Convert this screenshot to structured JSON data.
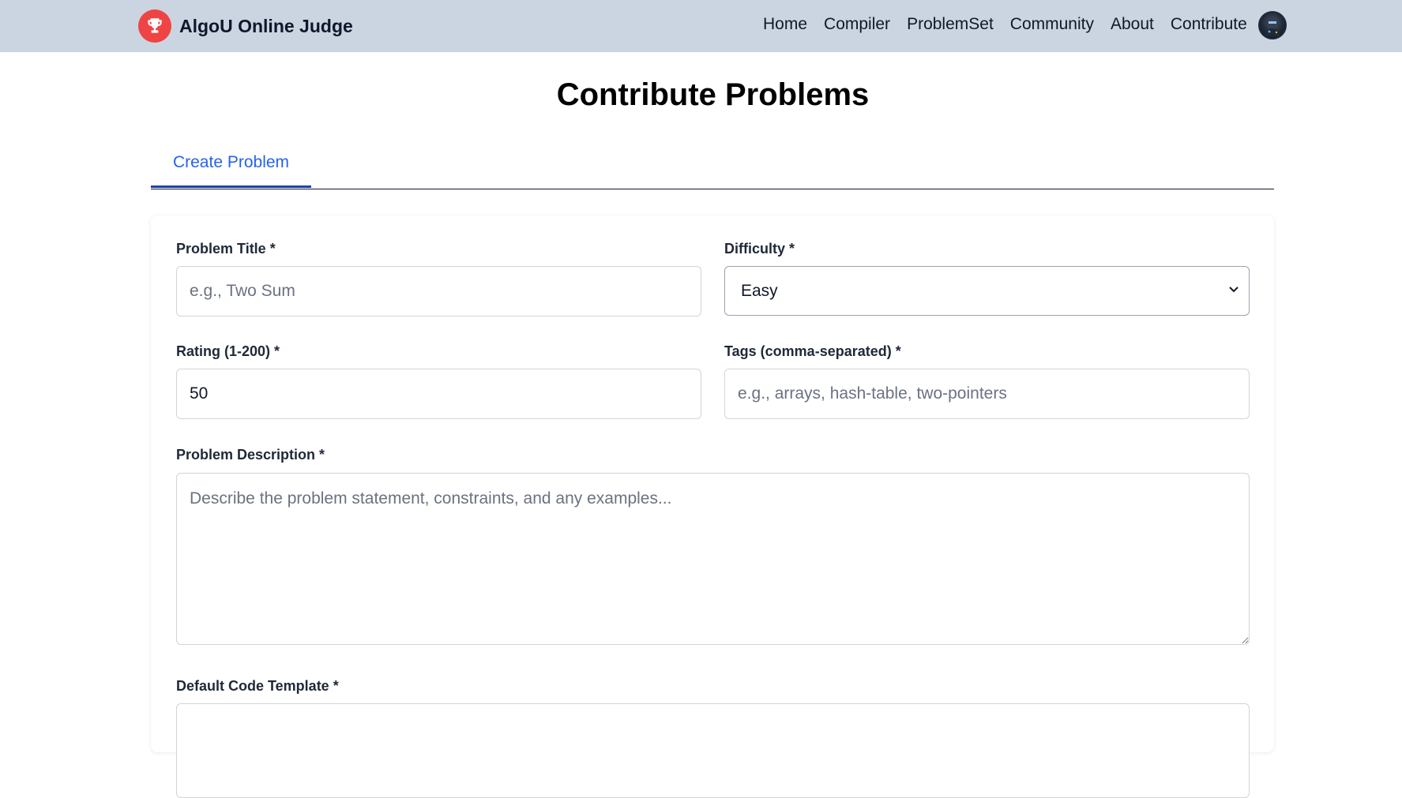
{
  "header": {
    "brand": "AlgoU Online Judge",
    "nav": [
      "Home",
      "Compiler",
      "ProblemSet",
      "Community",
      "About",
      "Contribute"
    ]
  },
  "page": {
    "title": "Contribute Problems",
    "tabs": [
      "Create Problem"
    ]
  },
  "form": {
    "title": {
      "label": "Problem Title *",
      "placeholder": "e.g., Two Sum",
      "value": ""
    },
    "difficulty": {
      "label": "Difficulty *",
      "value": "Easy"
    },
    "rating": {
      "label": "Rating (1-200) *",
      "value": "50"
    },
    "tags": {
      "label": "Tags (comma-separated) *",
      "placeholder": "e.g., arrays, hash-table, two-pointers",
      "value": ""
    },
    "description": {
      "label": "Problem Description *",
      "placeholder": "Describe the problem statement, constraints, and any examples...",
      "value": ""
    },
    "template": {
      "label": "Default Code Template *"
    }
  },
  "colors": {
    "navbar_bg": "#cbd5e1",
    "brand_logo": "#ef4444",
    "active_tab": "#2563eb",
    "tab_underline": "#1e40af"
  },
  "icons": {
    "brand": "trophy-icon",
    "select": "chevron-down-icon",
    "avatar": "user-avatar"
  }
}
